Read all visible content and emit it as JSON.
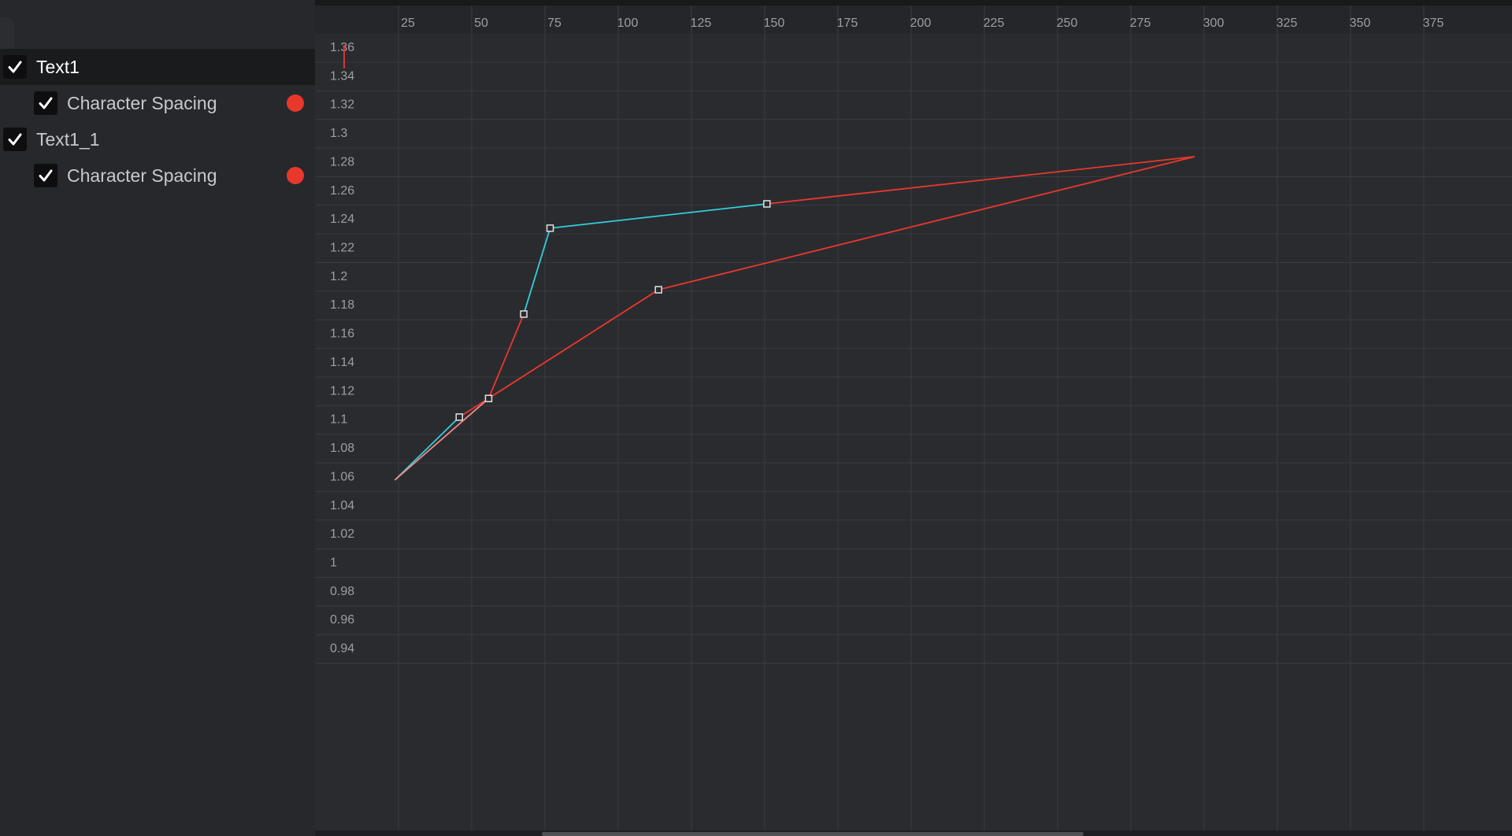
{
  "tree": [
    {
      "id": "text1",
      "label": "Text1",
      "level": 0,
      "checked": true,
      "selected": true,
      "has_dot": false
    },
    {
      "id": "text1-character-spacing",
      "label": "Character Spacing",
      "level": 1,
      "checked": true,
      "selected": false,
      "has_dot": true
    },
    {
      "id": "text1-1",
      "label": "Text1_1",
      "level": 0,
      "checked": true,
      "selected": false,
      "has_dot": false
    },
    {
      "id": "text1-1-character-spacing",
      "label": "Character Spacing",
      "level": 1,
      "checked": true,
      "selected": false,
      "has_dot": true
    }
  ],
  "colors": {
    "curve_red": "#e8382c",
    "curve_cyan": "#2fd0dc",
    "grid_line": "#3a3b40",
    "playhead": "#d4343a"
  },
  "graph": {
    "x_ticks": [
      "25",
      "50",
      "75",
      "100",
      "125",
      "150",
      "175",
      "200",
      "225",
      "250",
      "275",
      "300",
      "325",
      "350",
      "375"
    ],
    "y_ticks": [
      "1.36",
      "1.34",
      "1.32",
      "1.3",
      "1.28",
      "1.26",
      "1.24",
      "1.22",
      "1.2",
      "1.18",
      "1.16",
      "1.14",
      "1.12",
      "1.1",
      "1.08",
      "1.06",
      "1.04",
      "1.02",
      "1",
      "0.98",
      "0.96",
      "0.94"
    ],
    "x_range": [
      0,
      400
    ],
    "y_range": [
      0.93,
      1.37
    ],
    "playhead_x": 8,
    "curves": [
      {
        "name": "text1-character-spacing-curve",
        "keyframes": [
          [
            20,
            1.057
          ],
          [
            42,
            1.101
          ],
          [
            110,
            1.19
          ],
          [
            293,
            1.283
          ]
        ],
        "segment_colors": [
          "cyan",
          "red",
          "red"
        ],
        "handles": [
          [
            64,
            1.233
          ],
          [
            52,
            1.173
          ]
        ],
        "handle_segments": [
          [
            "cyan",
            "red"
          ]
        ]
      },
      {
        "name": "text1-1-character-spacing-curve",
        "keyframes": [
          [
            20,
            1.057
          ],
          [
            52,
            1.114
          ],
          [
            64,
            1.173
          ],
          [
            73,
            1.233
          ],
          [
            147,
            1.25
          ],
          [
            293,
            1.283
          ]
        ],
        "segment_colors": [
          "pink",
          "red",
          "cyan",
          "cyan",
          "red"
        ],
        "handles": [],
        "handle_segments": []
      }
    ]
  }
}
